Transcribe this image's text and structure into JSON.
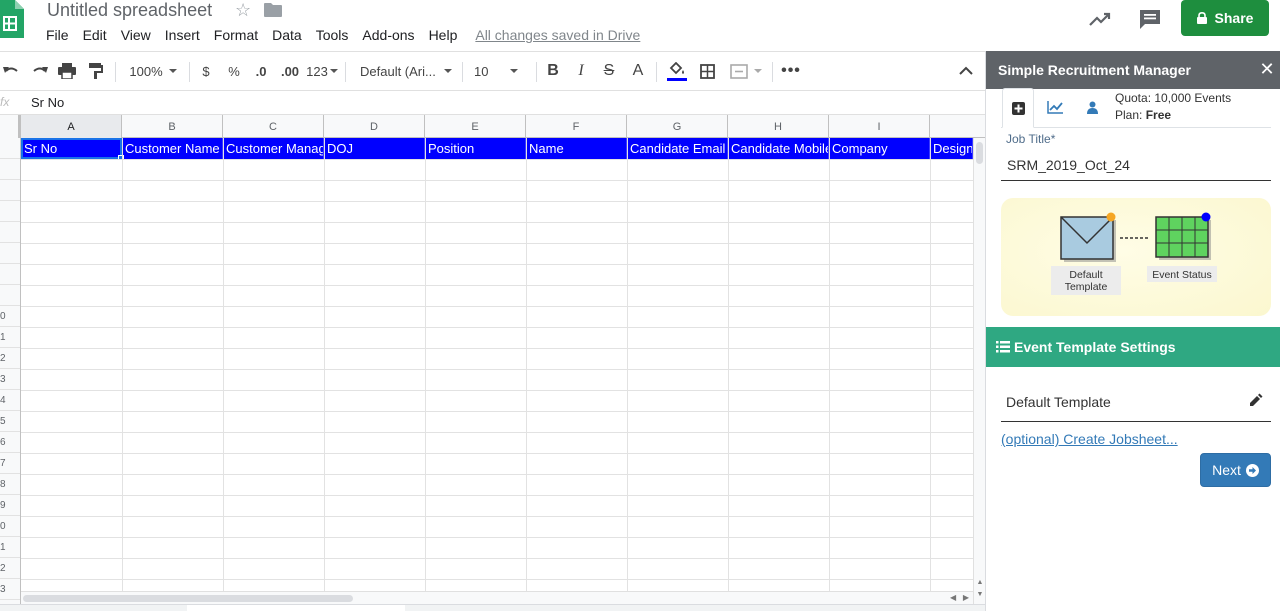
{
  "window": {
    "doc_title": "Untitled spreadsheet",
    "saved_status": "All changes saved in Drive",
    "share_label": "Share"
  },
  "menu": [
    "File",
    "Edit",
    "View",
    "Insert",
    "Format",
    "Data",
    "Tools",
    "Add-ons",
    "Help"
  ],
  "toolbar": {
    "zoom": "100%",
    "currency": "$",
    "percent": "%",
    "decimal_decrease": ".0",
    "decimal_increase": ".00",
    "number_format": "123",
    "font": "Default (Ari...",
    "font_size": "10",
    "bold": "B",
    "italic": "I",
    "strikethrough": "S",
    "text_color": "A",
    "fill_color_bar": "#0000ff"
  },
  "formula_bar": {
    "fx": "fx",
    "value": "Sr No"
  },
  "grid": {
    "columns": [
      "A",
      "B",
      "C",
      "D",
      "E",
      "F",
      "G",
      "H",
      "I",
      ""
    ],
    "header_row": [
      "Sr No",
      "Customer Name",
      "Customer Manager",
      "DOJ",
      "Position",
      "Name",
      "Candidate Email",
      "Candidate Mobile",
      "Company",
      "Designation"
    ],
    "header_fill": "#0000ff",
    "row_numbers": [
      "",
      "",
      "",
      "",
      "",
      "",
      "",
      "",
      "0",
      "1",
      "2",
      "3",
      "4",
      "5",
      "6",
      "7",
      "8",
      "9",
      "0",
      "1",
      "2",
      "3"
    ]
  },
  "sidebar": {
    "title": "Simple Recruitment Manager",
    "close": "✕",
    "quota": "Quota: 10,000 Events",
    "plan_label": "Plan:",
    "plan_value": "Free",
    "job_title_label": "Job Title*",
    "job_title_value": "SRM_2019_Oct_24",
    "diagram": {
      "node1_label_line1": "Default",
      "node1_label_line2": "Template",
      "node2_label": "Event Status",
      "node1_dot_color": "#f5a623",
      "node2_dot_color": "#0000ff"
    },
    "settings_title": "Event Template Settings",
    "settings_color": "#2fa882",
    "template_name": "Default Template",
    "jobsheet_link": "(optional) Create Jobsheet...",
    "next_label": "Next"
  }
}
